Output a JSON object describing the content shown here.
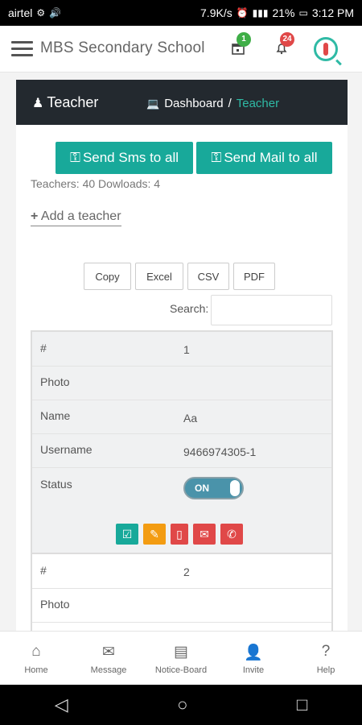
{
  "statusbar": {
    "carrier": "airtel",
    "speed": "7.9K/s",
    "battery": "21%",
    "time": "3:12 PM"
  },
  "app": {
    "title": "MBS Secondary School",
    "calendar_badge": "1",
    "bell_badge": "24"
  },
  "header": {
    "page": "Teacher",
    "crumb_home": "Dashboard",
    "crumb_sep": "/",
    "crumb_active": "Teacher"
  },
  "actions": {
    "sms": "Send Sms to all",
    "mail": "Send Mail to all"
  },
  "counts": "Teachers: 40 Dowloads: 4",
  "add_teacher": "Add a teacher",
  "export": {
    "copy": "Copy",
    "excel": "Excel",
    "csv": "CSV",
    "pdf": "PDF"
  },
  "search": {
    "label": "Search:",
    "placeholder": ""
  },
  "labels": {
    "num": "#",
    "photo": "Photo",
    "name": "Name",
    "username": "Username",
    "status": "Status"
  },
  "records": [
    {
      "num": "1",
      "name": "Aa",
      "username": "9466974305-1",
      "status": "ON"
    },
    {
      "num": "2"
    }
  ],
  "nav": [
    {
      "label": "Home",
      "icon": "home-icon"
    },
    {
      "label": "Message",
      "icon": "envelope-icon"
    },
    {
      "label": "Notice-Board",
      "icon": "clipboard-icon"
    },
    {
      "label": "Invite",
      "icon": "user-plus-icon"
    },
    {
      "label": "Help",
      "icon": "question-icon"
    }
  ],
  "colors": {
    "teal": "#18a99a",
    "dark": "#23292f",
    "green_badge": "#3fae47",
    "red_badge": "#e04848"
  }
}
